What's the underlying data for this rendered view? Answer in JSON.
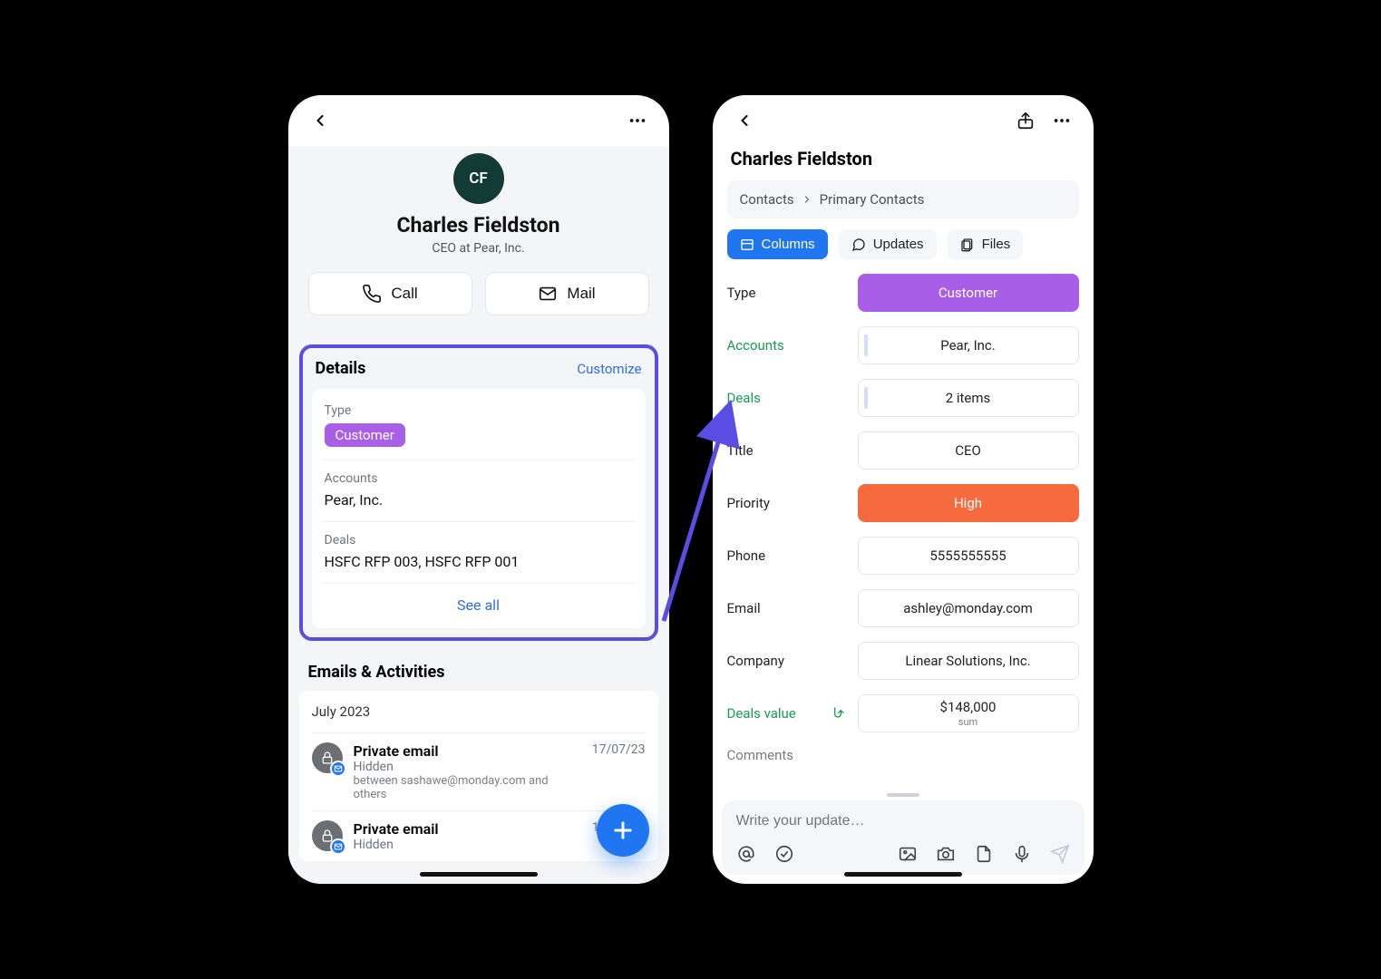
{
  "left": {
    "avatar_initials": "CF",
    "contact_name": "Charles Fieldston",
    "contact_subtitle": "CEO at Pear, Inc.",
    "actions": {
      "call": "Call",
      "mail": "Mail"
    },
    "details": {
      "title": "Details",
      "customize": "Customize",
      "rows": {
        "type_label": "Type",
        "type_value": "Customer",
        "accounts_label": "Accounts",
        "accounts_value": "Pear, Inc.",
        "deals_label": "Deals",
        "deals_value": "HSFC RFP 003, HSFC RFP 001"
      },
      "see_all": "See all"
    },
    "activities": {
      "section_title": "Emails & Activities",
      "month": "July 2023",
      "items": [
        {
          "title": "Private email",
          "sub": "Hidden",
          "meta": "between sashawe@monday.com and others",
          "date": "17/07/23"
        },
        {
          "title": "Private email",
          "sub": "Hidden",
          "meta": "",
          "date": "10/07/23"
        }
      ]
    }
  },
  "right": {
    "contact_name": "Charles Fieldston",
    "breadcrumb": {
      "root": "Contacts",
      "leaf": "Primary Contacts"
    },
    "tabs": {
      "columns": "Columns",
      "updates": "Updates",
      "files": "Files"
    },
    "fields": {
      "type_label": "Type",
      "type_value": "Customer",
      "accounts_label": "Accounts",
      "accounts_value": "Pear, Inc.",
      "deals_label": "Deals",
      "deals_value": "2 items",
      "title_label": "Title",
      "title_value": "CEO",
      "priority_label": "Priority",
      "priority_value": "High",
      "phone_label": "Phone",
      "phone_value": "5555555555",
      "email_label": "Email",
      "email_value": "ashley@monday.com",
      "company_label": "Company",
      "company_value": "Linear Solutions, Inc.",
      "dealsvalue_label": "Deals value",
      "dealsvalue_value": "$148,000",
      "dealsvalue_sub": "sum",
      "comments_label": "Comments"
    },
    "update_placeholder": "Write your update…"
  }
}
